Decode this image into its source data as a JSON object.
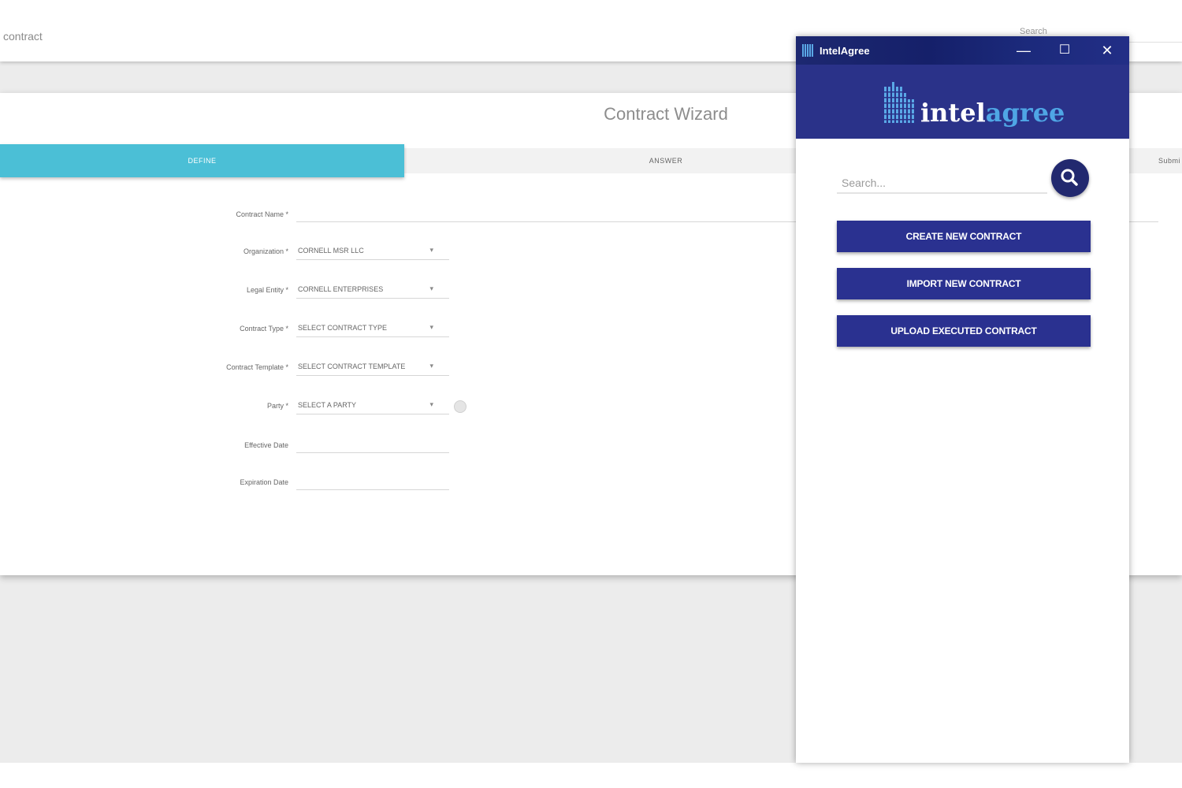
{
  "app": {
    "title": "contract",
    "search_placeholder": "Search"
  },
  "wizard": {
    "title": "Contract Wizard",
    "steps": [
      {
        "label": "DEFINE",
        "active": true
      },
      {
        "label": "ANSWER",
        "active": false
      },
      {
        "label": "Submi",
        "active": false
      }
    ],
    "fields": [
      {
        "label": "Contract Name *",
        "value": ""
      },
      {
        "label": "Organization *",
        "value": "CORNELL MSR LLC"
      },
      {
        "label": "Legal Entity *",
        "value": "CORNELL ENTERPRISES"
      },
      {
        "label": "Contract Type *",
        "value": "SELECT CONTRACT TYPE"
      },
      {
        "label": "Contract Template *",
        "value": "SELECT CONTRACT TEMPLATE"
      },
      {
        "label": "Party *",
        "value": "SELECT A PARTY"
      },
      {
        "label": "Effective Date",
        "value": ""
      },
      {
        "label": "Expiration Date",
        "value": ""
      }
    ],
    "caret_glyph": "▾"
  },
  "popup": {
    "window_title": "IntelAgree",
    "minimize_glyph": "—",
    "maximize_glyph": "☐",
    "close_glyph": "✕",
    "brand_part1": "intel",
    "brand_part2": "agree",
    "search_placeholder": "Search...",
    "buttons": {
      "create": "CREATE NEW CONTRACT",
      "import": "IMPORT NEW CONTRACT",
      "upload": "UPLOAD EXECUTED CONTRACT"
    }
  },
  "colors": {
    "accent_teal": "#4bbfd6",
    "brand_navy": "#2a3289",
    "brand_light_blue": "#4fa6e5"
  }
}
